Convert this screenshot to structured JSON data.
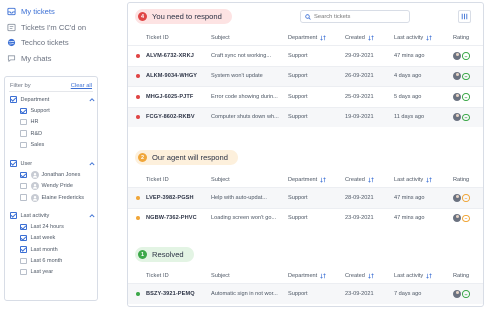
{
  "nav": {
    "items": [
      {
        "label": "My tickets",
        "icon": "inbox-icon"
      },
      {
        "label": "Tickets I'm CC'd on",
        "icon": "cc-icon"
      },
      {
        "label": "Techco tickets",
        "icon": "globe-icon"
      },
      {
        "label": "My chats",
        "icon": "chat-icon"
      }
    ]
  },
  "filter": {
    "title": "Filter by",
    "clear_all": "Clear all",
    "department": {
      "label": "Department",
      "options": [
        "Support",
        "HR",
        "R&D",
        "Sales"
      ]
    },
    "user": {
      "label": "User",
      "options": [
        "Jonathan Jones",
        "Wendy Pride",
        "Elaine Fredericks"
      ]
    },
    "last_activity": {
      "label": "Last activity",
      "options": [
        "Last 24 hours",
        "Last week",
        "Last month",
        "Last 6 month",
        "Last year"
      ]
    }
  },
  "search": {
    "placeholder": "Search tickets"
  },
  "columns": {
    "ticket_id": "Ticket ID",
    "subject": "Subject",
    "department": "Department",
    "created": "Created",
    "last_activity": "Last activity",
    "rating": "Rating"
  },
  "sections": [
    {
      "number": "4",
      "title": "You need to respond",
      "rows": [
        {
          "id": "ALVM-6732-XRKJ",
          "subject": "Craft sync not working...",
          "department": "Support",
          "created": "29-09-2021",
          "last_activity": "47 mins ago"
        },
        {
          "id": "ALKM-9034-WHGY",
          "subject": "System won't update",
          "department": "Support",
          "created": "26-09-2021",
          "last_activity": "4 days ago"
        },
        {
          "id": "MHGJ-6025-PJTF",
          "subject": "Error code showing durin...",
          "department": "Support",
          "created": "25-09-2021",
          "last_activity": "5 days ago"
        },
        {
          "id": "FCGY-8602-RKBV",
          "subject": "Computer shuts down wh...",
          "department": "Support",
          "created": "19-09-2021",
          "last_activity": "11 days ago"
        }
      ]
    },
    {
      "number": "2",
      "title": "Our agent will respond",
      "rows": [
        {
          "id": "LVEP-3982-PGSH",
          "subject": "Help with auto-updat...",
          "department": "Support",
          "created": "28-09-2021",
          "last_activity": "47 mins ago"
        },
        {
          "id": "NGBW-7362-PHVC",
          "subject": "Loading screen won't go...",
          "department": "Support",
          "created": "23-09-2021",
          "last_activity": "47 mins ago"
        }
      ]
    },
    {
      "number": "1",
      "title": "Resolved",
      "rows": [
        {
          "id": "BSZY-3921-PEMQ",
          "subject": "Automatic sign in not wor...",
          "department": "Support",
          "created": "23-09-2021",
          "last_activity": "7 days ago"
        }
      ]
    }
  ],
  "colors": {
    "accent": "#3b6fd4",
    "respond_pill": "#fde3e3",
    "respond_badge": "#e04646",
    "agent_pill": "#fdf0dc",
    "agent_badge": "#f0a63a",
    "resolved_pill": "#e3f4e4",
    "resolved_badge": "#3da84a",
    "rating_good": "#3da84a",
    "rating_neutral": "#f0a63a"
  }
}
